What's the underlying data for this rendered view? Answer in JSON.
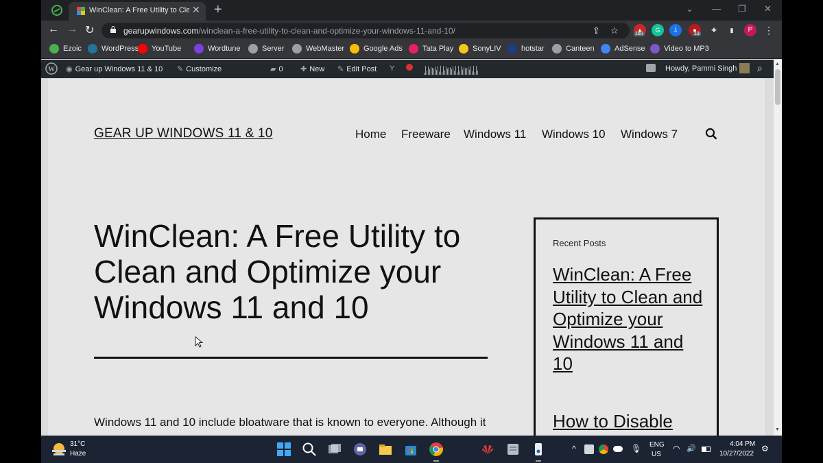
{
  "browser": {
    "tab_title": "WinClean: A Free Utility to Clean",
    "tab_close": "✕",
    "new_tab": "+",
    "url_host": "gearupwindows.com",
    "url_path": "/winclean-a-free-utility-to-clean-and-optimize-your-windows-11-and-10/",
    "ext_badge_1": "160",
    "ext_badge_2": "13",
    "profile_initial": "P"
  },
  "bookmarks": [
    {
      "label": "Ezoic",
      "icon": "ezoic-icon",
      "color": "#4caf50"
    },
    {
      "label": "WordPress",
      "icon": "wordpress-icon",
      "color": "#21759b"
    },
    {
      "label": "YouTube",
      "icon": "youtube-icon",
      "color": "#ff0000"
    },
    {
      "label": "Wordtune",
      "icon": "wordtune-icon",
      "color": "#7b3fe4"
    },
    {
      "label": "Server",
      "icon": "globe-icon",
      "color": "#9aa0a6"
    },
    {
      "label": "WebMaster",
      "icon": "webmaster-icon",
      "color": "#9aa0a6"
    },
    {
      "label": "Google Ads",
      "icon": "google-ads-icon",
      "color": "#fbbc04"
    },
    {
      "label": "Tata Play",
      "icon": "tata-play-icon",
      "color": "#e91e63"
    },
    {
      "label": "SonyLIV",
      "icon": "sonyliv-icon",
      "color": "#f5c518"
    },
    {
      "label": "hotstar",
      "icon": "hotstar-icon",
      "color": "#1f3c88"
    },
    {
      "label": "Canteen",
      "icon": "canteen-icon",
      "color": "#9aa0a6"
    },
    {
      "label": "AdSense",
      "icon": "google-icon",
      "color": "#4285f4"
    },
    {
      "label": "Video to MP3",
      "icon": "video-mp3-icon",
      "color": "#7e57c2"
    }
  ],
  "adminbar": {
    "site_name": "Gear up Windows 11 & 10",
    "customize": "Customize",
    "comments_count": "0",
    "new": "New",
    "edit_post": "Edit Post",
    "howdy": "Howdy, Pammi Singh"
  },
  "site": {
    "title": "GEAR UP WINDOWS 11 & 10",
    "nav": [
      "Home",
      "Freeware",
      "Windows 11",
      "Windows 10",
      "Windows 7"
    ]
  },
  "post": {
    "title": "WinClean: A Free Utility to Clean and Optimize your Windows 11 and 10",
    "excerpt": "Windows 11 and 10 include bloatware that is known to everyone. Although it"
  },
  "sidebar": {
    "widget_title": "Recent Posts",
    "recent_posts": [
      "WinClean: A Free Utility to Clean and Optimize your Windows 11 and 10",
      "How to Disable"
    ]
  },
  "taskbar": {
    "weather_temp": "31°C",
    "weather_desc": "Haze",
    "lang": "ENG",
    "region": "US",
    "time": "4:04 PM",
    "date": "10/27/2022"
  }
}
